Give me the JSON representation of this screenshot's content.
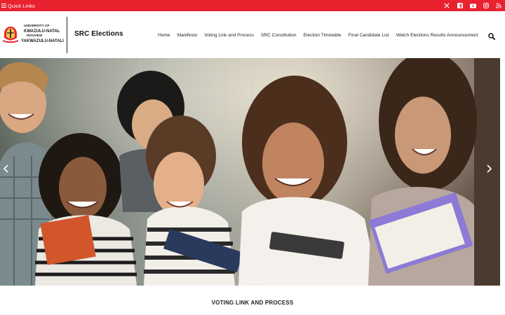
{
  "topbar": {
    "quick_links_label": "Quick Links",
    "social_icons": [
      "x-twitter-icon",
      "facebook-icon",
      "youtube-icon",
      "instagram-icon",
      "rss-icon"
    ],
    "color": "#e8222e"
  },
  "header": {
    "logo": {
      "line1": "UNIVERSITY OF",
      "line2": "KWAZULU-NATAL",
      "line3": "INYUVESI",
      "line4": "YAKWAZULU-NATALI"
    },
    "site_title": "SRC Elections"
  },
  "nav": {
    "items": [
      {
        "label": "Home"
      },
      {
        "label": "Manifesto"
      },
      {
        "label": "Voting Link and Process"
      },
      {
        "label": "SRC Constitution"
      },
      {
        "label": "Election Timetable"
      },
      {
        "label": "Final Candidate List"
      },
      {
        "label": "Watch Elections Results Announcement"
      }
    ],
    "search_icon": "search-icon"
  },
  "hero": {
    "image": "photo of smiling students holding books",
    "slides": 3,
    "active_slide": 1
  },
  "main": {
    "section_title": "VOTING LINK AND PROCESS"
  }
}
